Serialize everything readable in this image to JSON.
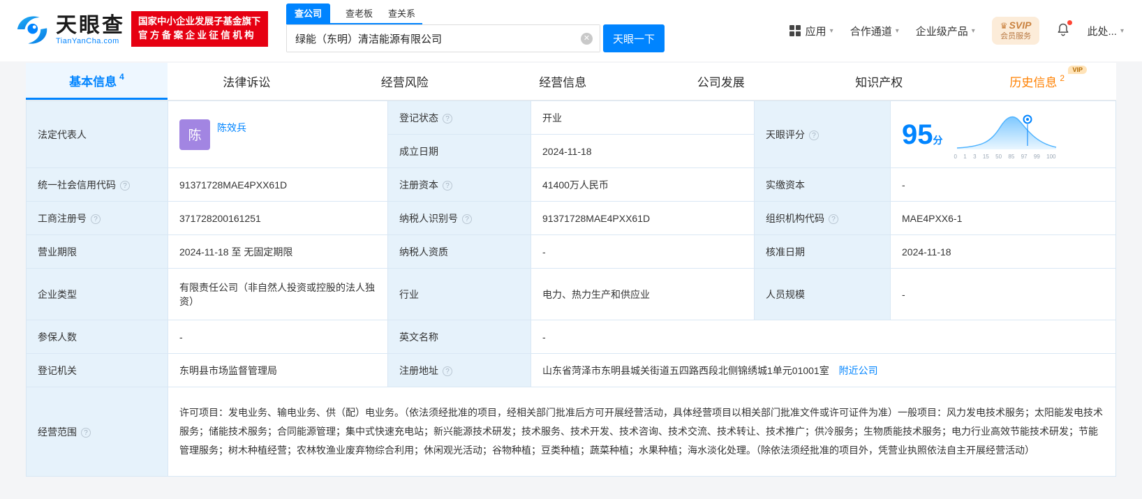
{
  "colors": {
    "brand_blue": "#0084ff",
    "badge_red": "#e60012",
    "status_green": "#00b340",
    "history_orange": "#ff8000",
    "avatar_purple": "#a285e2",
    "label_cell_bg": "#e6f2fb"
  },
  "icons": {
    "caret_down": "▾",
    "clear": "✕",
    "help": "?",
    "crown": "♛"
  },
  "header": {
    "logo_cn": "天眼查",
    "logo_en": "TianYanCha.com",
    "badge_line1": "国家中小企业发展子基金旗下",
    "badge_line2": "官方备案企业征信机构",
    "search_tabs": [
      {
        "label": "查公司",
        "active": true
      },
      {
        "label": "查老板",
        "active": false
      },
      {
        "label": "查关系",
        "active": false
      }
    ],
    "search_value": "绿能（东明）清洁能源有限公司",
    "search_button": "天眼一下",
    "nav_app": "应用",
    "nav_coop": "合作通道",
    "nav_enterprise": "企业级产品",
    "svip_line1": "SVIP",
    "svip_line2": "会员服务",
    "more_text": "此处..."
  },
  "tabs": [
    {
      "label": "基本信息",
      "count": "4"
    },
    {
      "label": "法律诉讼",
      "count": ""
    },
    {
      "label": "经营风险",
      "count": ""
    },
    {
      "label": "经营信息",
      "count": ""
    },
    {
      "label": "公司发展",
      "count": ""
    },
    {
      "label": "知识产权",
      "count": ""
    },
    {
      "label": "历史信息",
      "count": "2",
      "vip": "VIP"
    }
  ],
  "table": {
    "legal_rep": {
      "label": "法定代表人",
      "avatar": "陈",
      "name": "陈效兵"
    },
    "reg_status": {
      "label": "登记状态",
      "value": "开业"
    },
    "establish_date": {
      "label": "成立日期",
      "value": "2024-11-18"
    },
    "score": {
      "label": "天眼评分",
      "value": "95",
      "unit": "分",
      "axis": [
        "0",
        "1",
        "3",
        "15",
        "50",
        "85",
        "97",
        "99",
        "100"
      ]
    },
    "credit_code": {
      "label": "统一社会信用代码",
      "value": "91371728MAE4PXX61D"
    },
    "reg_capital": {
      "label": "注册资本",
      "value": "41400万人民币"
    },
    "paid_capital": {
      "label": "实缴资本",
      "value": "-"
    },
    "reg_number": {
      "label": "工商注册号",
      "value": "371728200161251"
    },
    "taxpayer_id": {
      "label": "纳税人识别号",
      "value": "91371728MAE4PXX61D"
    },
    "org_code": {
      "label": "组织机构代码",
      "value": "MAE4PXX6-1"
    },
    "business_term": {
      "label": "营业期限",
      "value": "2024-11-18 至 无固定期限"
    },
    "taxpayer_qual": {
      "label": "纳税人资质",
      "value": "-"
    },
    "approval_date": {
      "label": "核准日期",
      "value": "2024-11-18"
    },
    "company_type": {
      "label": "企业类型",
      "value": "有限责任公司（非自然人投资或控股的法人独资）"
    },
    "industry": {
      "label": "行业",
      "value": "电力、热力生产和供应业"
    },
    "staff_size": {
      "label": "人员规模",
      "value": "-"
    },
    "insured_count": {
      "label": "参保人数",
      "value": "-"
    },
    "english_name": {
      "label": "英文名称",
      "value": "-"
    },
    "reg_authority": {
      "label": "登记机关",
      "value": "东明县市场监督管理局"
    },
    "reg_address": {
      "label": "注册地址",
      "value": "山东省菏泽市东明县城关街道五四路西段北侧锦绣城1单元01001室",
      "link": "附近公司"
    },
    "business_scope": {
      "label": "经营范围",
      "value": "许可项目：发电业务、输电业务、供（配）电业务。（依法须经批准的项目，经相关部门批准后方可开展经营活动，具体经营项目以相关部门批准文件或许可证件为准）一般项目：风力发电技术服务；太阳能发电技术服务；储能技术服务；合同能源管理；集中式快速充电站；新兴能源技术研发；技术服务、技术开发、技术咨询、技术交流、技术转让、技术推广；供冷服务；生物质能技术服务；电力行业高效节能技术研发；节能管理服务；树木种植经营；农林牧渔业废弃物综合利用；休闲观光活动；谷物种植；豆类种植；蔬菜种植；水果种植；海水淡化处理。（除依法须经批准的项目外，凭营业执照依法自主开展经营活动）"
    }
  }
}
